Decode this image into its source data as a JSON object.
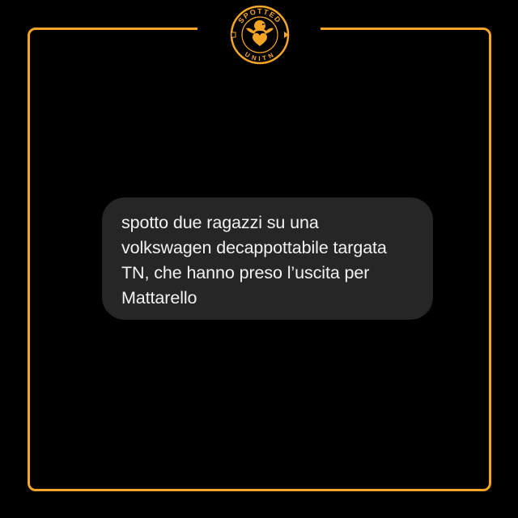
{
  "logo": {
    "top_text": "SPOTTED",
    "bottom_text": "UNITN",
    "icon": "eagle-heart-emblem",
    "colors": {
      "accent": "#f4a526",
      "background": "#000000"
    }
  },
  "post": {
    "lines": [
      "spotto due ragazzi su una",
      "volkswagen decappottabile targata",
      "TN, che hanno preso l’uscita per",
      "Mattarello"
    ],
    "bubble_color": "#262626",
    "text_color": "#f2f2f2"
  },
  "frame": {
    "border_color": "#f4a526"
  }
}
